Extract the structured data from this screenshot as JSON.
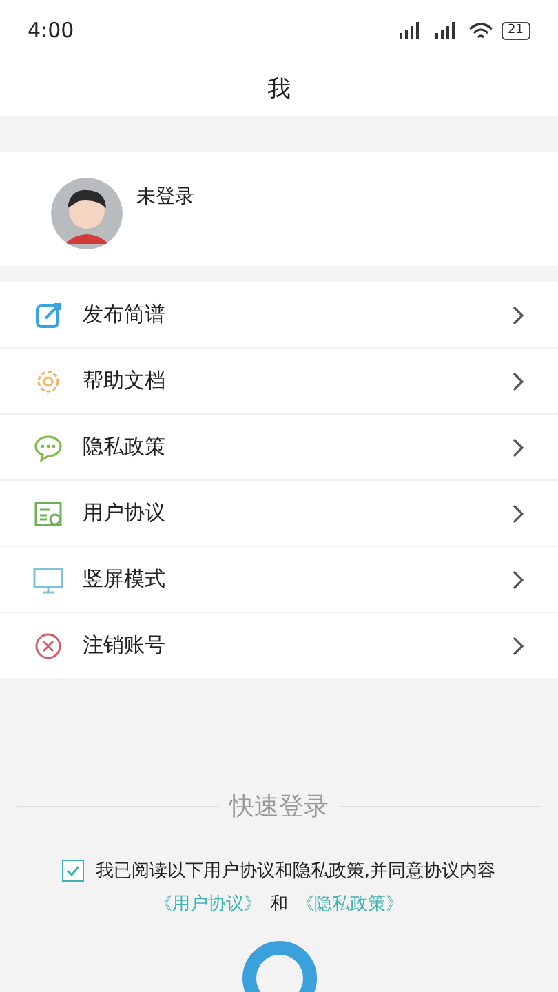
{
  "status_bar": {
    "time": "4:00",
    "battery": "21"
  },
  "header": {
    "title": "我"
  },
  "profile": {
    "name": "未登录"
  },
  "menu": [
    {
      "label": "发布简谱"
    },
    {
      "label": "帮助文档"
    },
    {
      "label": "隐私政策"
    },
    {
      "label": "用户协议"
    },
    {
      "label": "竖屏模式"
    },
    {
      "label": "注销账号"
    }
  ],
  "quick_login": {
    "title": "快速登录",
    "agreement": {
      "checked": true,
      "text": "我已阅读以下用户协议和隐私政策,并同意协议内容"
    },
    "link_user": "《用户协议》",
    "conj": "和",
    "link_privacy": "《隐私政策》"
  }
}
